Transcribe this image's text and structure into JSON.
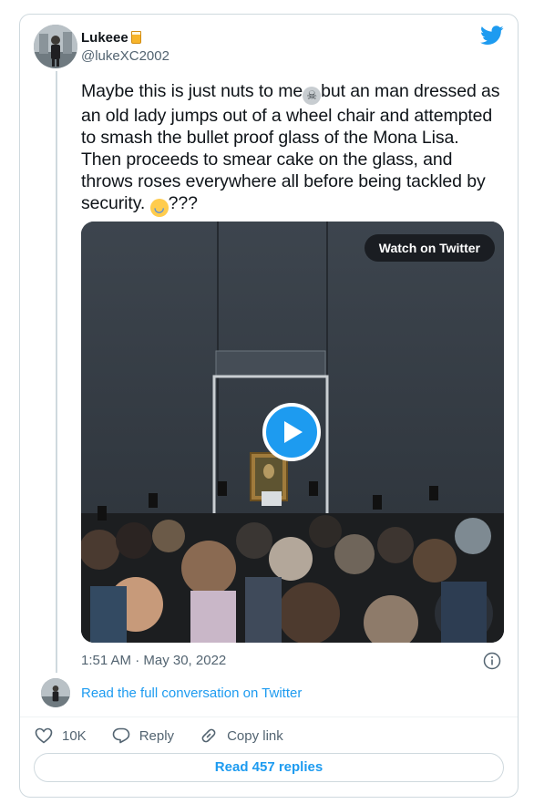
{
  "tweet": {
    "author_name": "Lukeee",
    "author_handle": "@lukeXC2002",
    "text_parts": [
      "Maybe this is just nuts to me",
      "but an man dressed as an old lady jumps out of a wheel chair and attempted to smash the bullet proof glass of the Mona Lisa. Then proceeds to smear cake on the glass, and throws roses everywhere all before being tackled by security.",
      "???"
    ],
    "emojis": [
      "skull",
      "face-with-tears-of-joy"
    ],
    "timestamp": "1:51 AM · May 30, 2022"
  },
  "media": {
    "watch_label": "Watch on Twitter",
    "play_icon": "play-icon"
  },
  "conversation": {
    "link_label": "Read the full conversation on Twitter"
  },
  "actions": {
    "likes": "10K",
    "reply_label": "Reply",
    "copy_label": "Copy link",
    "read_replies_label": "Read 457 replies"
  },
  "colors": {
    "accent": "#1d9bf0",
    "text": "#0f1419",
    "muted": "#536471",
    "border": "#cfd9de"
  }
}
